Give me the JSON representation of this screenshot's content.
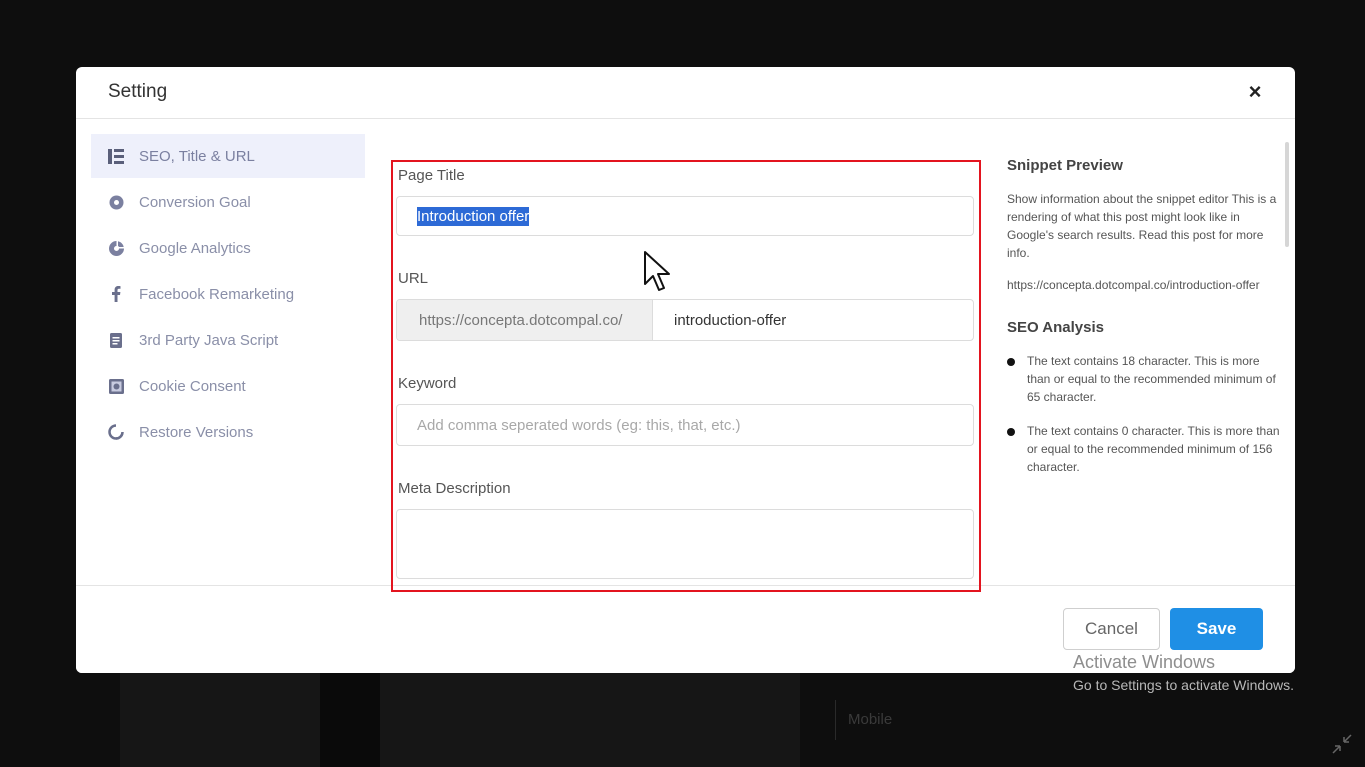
{
  "modal": {
    "title": "Setting",
    "close_label": "×"
  },
  "sidebar": {
    "items": [
      {
        "label": "SEO, Title & URL",
        "icon": "list-icon",
        "active": true
      },
      {
        "label": "Conversion Goal",
        "icon": "goal-circle-icon",
        "active": false
      },
      {
        "label": "Google Analytics",
        "icon": "analytics-icon",
        "active": false
      },
      {
        "label": "Facebook Remarketing",
        "icon": "facebook-icon",
        "active": false
      },
      {
        "label": "3rd Party Java Script",
        "icon": "script-icon",
        "active": false
      },
      {
        "label": "Cookie Consent",
        "icon": "cookie-icon",
        "active": false
      },
      {
        "label": "Restore Versions",
        "icon": "restore-icon",
        "active": false
      }
    ]
  },
  "form": {
    "page_title_label": "Page Title",
    "page_title_value": "Introduction offer",
    "url_label": "URL",
    "url_prefix": "https://concepta.dotcompal.co/",
    "url_slug": "introduction-offer",
    "keyword_label": "Keyword",
    "keyword_placeholder": "Add comma seperated words (eg: this, that, etc.)",
    "meta_label": "Meta Description",
    "meta_value": ""
  },
  "snippet": {
    "heading": "Snippet Preview",
    "description": "Show information about the snippet editor This is a rendering of what this post might look like in Google's search results. Read this post for more info.",
    "url": "https://concepta.dotcompal.co/introduction-offer"
  },
  "seo": {
    "heading": "SEO Analysis",
    "items": [
      "The text contains 18 character. This is more than or equal to the recommended minimum of 65 character.",
      "The text contains 0 character. This is more than or equal to the recommended minimum of 156 character."
    ]
  },
  "footer": {
    "cancel_label": "Cancel",
    "save_label": "Save"
  },
  "background": {
    "mobile_label": "Mobile"
  },
  "watermark": {
    "title": "Activate Windows",
    "subtitle": "Go to Settings to activate Windows."
  },
  "colors": {
    "accent": "#1f8fe5",
    "highlight_border": "#e3141f",
    "sidebar_active_bg": "#eef0fb",
    "selection": "#2d6ad6"
  }
}
